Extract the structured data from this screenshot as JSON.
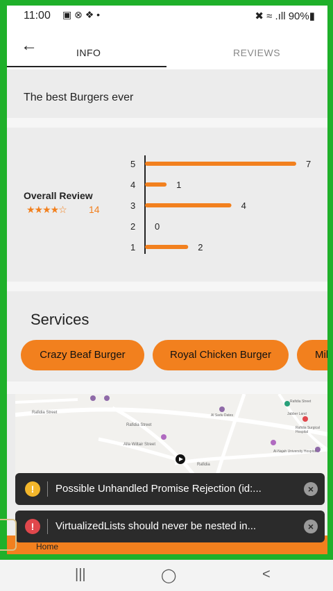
{
  "statusbar": {
    "time": "11:00",
    "left_icons": "▣ ⊗ ❖ •",
    "right_icons": "✖ ≈ .ıll 90%▮"
  },
  "tabs": {
    "info": "INFO",
    "reviews": "REVIEWS"
  },
  "description": "The best Burgers ever",
  "review": {
    "title": "Overall Review",
    "stars": "★★★★☆",
    "count": "14",
    "rating_counts": [
      {
        "label": "5",
        "count": 7
      },
      {
        "label": "4",
        "count": 1
      },
      {
        "label": "3",
        "count": 4
      },
      {
        "label": "2",
        "count": 0
      },
      {
        "label": "1",
        "count": 2
      }
    ],
    "max_count": 7
  },
  "services": {
    "title": "Services",
    "items": [
      "Crazy Beaf Burger",
      "Royal Chicken Burger",
      "Mil"
    ]
  },
  "map": {
    "labels": [
      "Rafidia Street",
      "Rafidia Street",
      "Alla Wiltair Street",
      "Al-Najah University Hospital",
      "Rafidia",
      "Jabber Land",
      "Al Sadu Dates",
      "Rafidia Surgical Hospital",
      "Rafidia Street"
    ]
  },
  "toasts": [
    {
      "type": "warning",
      "icon": "!",
      "color": "#f3b62b",
      "text": "Possible Unhandled Promise Rejection (id:..."
    },
    {
      "type": "error",
      "icon": "!",
      "color": "#e0474c",
      "text": "VirtualizedLists should never be nested in..."
    }
  ],
  "bottomnav": {
    "home": "Home"
  },
  "sysnav": {
    "recent": "|||",
    "home": "◯",
    "back": "<"
  },
  "colors": {
    "accent": "#f2801e",
    "frame": "#1fb02a"
  }
}
